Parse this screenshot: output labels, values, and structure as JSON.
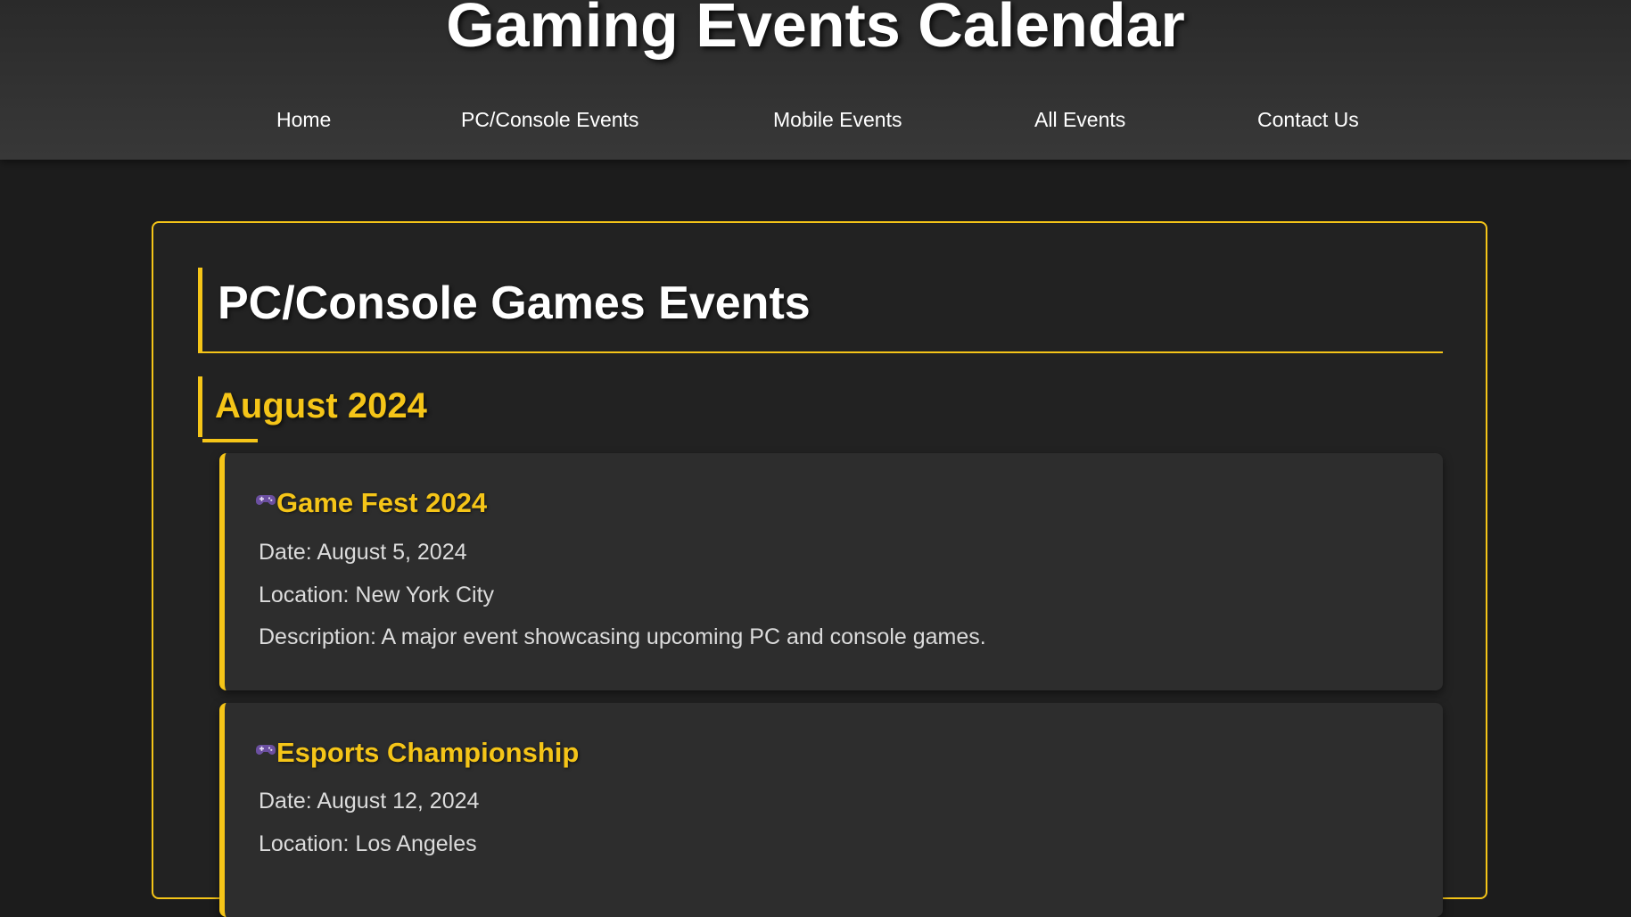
{
  "header": {
    "title": "Gaming Events Calendar"
  },
  "nav": {
    "items": [
      {
        "label": "Home"
      },
      {
        "label": "PC/Console Events"
      },
      {
        "label": "Mobile Events"
      },
      {
        "label": "All Events"
      },
      {
        "label": "Contact Us"
      }
    ]
  },
  "main": {
    "section_title": "PC/Console Games Events",
    "month": "August 2024",
    "events": [
      {
        "icon": "game-controller-icon",
        "title": "Game Fest 2024",
        "date": "Date: August 5, 2024",
        "location": "Location: New York City",
        "description": "Description: A major event showcasing upcoming PC and console games."
      },
      {
        "icon": "game-controller-icon",
        "title": "Esports Championship",
        "date": "Date: August 12, 2024",
        "location": "Location: Los Angeles"
      }
    ]
  },
  "colors": {
    "accent": "#f5c518",
    "background": "#1c1c1c",
    "header": "#333333",
    "card": "#2d2d2d",
    "icon": "#6b4fa0"
  }
}
